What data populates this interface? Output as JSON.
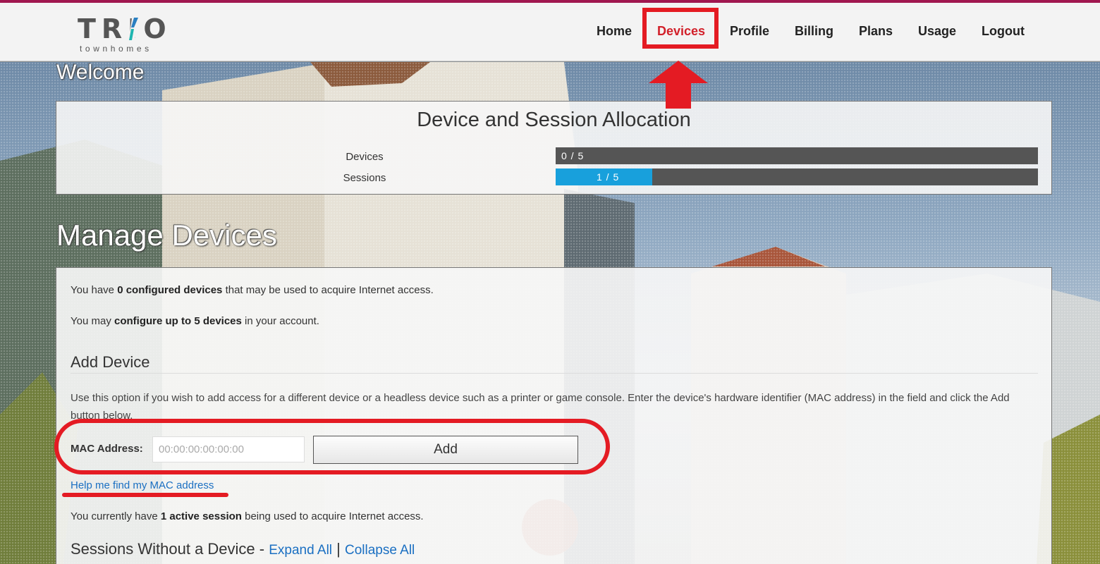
{
  "brand": {
    "logo_main": "TRIO",
    "logo_sub": "townhomes",
    "accent_colors": [
      "#2a7fc1",
      "#1fb5b0"
    ]
  },
  "nav": {
    "items": [
      {
        "label": "Home"
      },
      {
        "label": "Devices",
        "active": true
      },
      {
        "label": "Profile"
      },
      {
        "label": "Billing"
      },
      {
        "label": "Plans"
      },
      {
        "label": "Usage"
      },
      {
        "label": "Logout"
      }
    ]
  },
  "welcome": "Welcome",
  "allocation": {
    "title": "Device and Session Allocation",
    "devices": {
      "label": "Devices",
      "text": "0 / 5",
      "used": 0,
      "max": 5
    },
    "sessions": {
      "label": "Sessions",
      "text": "1 / 5",
      "used": 1,
      "max": 5
    }
  },
  "manage": {
    "title": "Manage Devices",
    "configured": {
      "pre": "You have ",
      "bold": "0 configured devices",
      "post": " that may be used to acquire Internet access."
    },
    "limit": {
      "pre": "You may ",
      "bold": "configure up to 5 devices",
      "post": " in your account."
    },
    "add_heading": "Add Device",
    "add_description": "Use this option if you wish to add access for a different device or a headless device such as a printer or game console. Enter the device's hardware identifier (MAC address) in the field and click the Add button below.",
    "mac_label": "MAC Address:",
    "mac_placeholder": "00:00:00:00:00:00",
    "add_button": "Add",
    "help_link": "Help me find my MAC address",
    "active_session": {
      "pre": "You currently have ",
      "bold": "1 active session",
      "post": " being used to acquire Internet access."
    },
    "sessions_heading": "Sessions Without a Device - ",
    "expand_all": "Expand All",
    "separator": "|",
    "collapse_all": "Collapse All"
  },
  "colors": {
    "nav_active": "#d2202a",
    "annotation_red": "#e41b23",
    "progress_fill": "#18a0dc",
    "progress_track": "#555555",
    "link": "#1a6fc2",
    "top_stripe": "#a0174f"
  }
}
